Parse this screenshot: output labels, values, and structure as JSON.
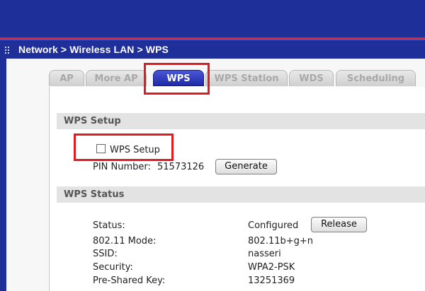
{
  "breadcrumb": "Network > Wireless LAN > WPS",
  "tabs": [
    {
      "label": "AP"
    },
    {
      "label": "More AP"
    },
    {
      "label": "WPS"
    },
    {
      "label": "WPS Station"
    },
    {
      "label": "WDS"
    },
    {
      "label": "Scheduling"
    }
  ],
  "wps_setup": {
    "title": "WPS Setup",
    "checkbox_label": "WPS Setup",
    "checked": false,
    "pin_label": "PIN Number:",
    "pin_value": "51573126",
    "generate_label": "Generate"
  },
  "wps_status": {
    "title": "WPS Status",
    "rows": [
      {
        "label": "Status:",
        "value": "Configured"
      },
      {
        "label": "802.11 Mode:",
        "value": "802.11b+g+n"
      },
      {
        "label": "SSID:",
        "value": "nasseri"
      },
      {
        "label": "Security:",
        "value": "WPA2-PSK"
      },
      {
        "label": "Pre-Shared Key:",
        "value": "13251369"
      }
    ],
    "release_label": "Release"
  },
  "colors": {
    "header_blue": "#1f2f9a",
    "highlight_red": "#e11b22",
    "active_tab": "#2f3ac0"
  }
}
